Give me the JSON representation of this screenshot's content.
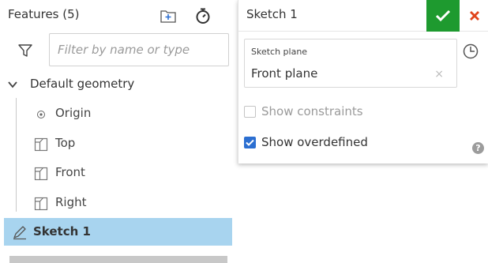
{
  "features_panel": {
    "title": "Features (5)",
    "filter": {
      "placeholder": "Filter by name or type",
      "value": ""
    },
    "group": {
      "label": "Default geometry",
      "items": [
        {
          "label": "Origin",
          "icon": "origin-point-icon"
        },
        {
          "label": "Top",
          "icon": "plane-icon"
        },
        {
          "label": "Front",
          "icon": "plane-icon"
        },
        {
          "label": "Right",
          "icon": "plane-icon"
        }
      ]
    },
    "sketch_item": {
      "label": "Sketch 1",
      "icon": "sketch-pencil-icon"
    }
  },
  "sketch_dialog": {
    "title": "Sketch 1",
    "sketch_plane_label": "Sketch plane",
    "sketch_plane_value": "Front plane",
    "clear_glyph": "×",
    "help_glyph": "?",
    "show_constraints": {
      "label": "Show constraints",
      "checked": false,
      "enabled": false
    },
    "show_overdefined": {
      "label": "Show overdefined",
      "checked": true,
      "enabled": true
    }
  },
  "colors": {
    "accept": "#1e9a2f",
    "cancel": "#e0441b",
    "selection": "#a8d4ef",
    "checkbox": "#2c6fd1"
  }
}
